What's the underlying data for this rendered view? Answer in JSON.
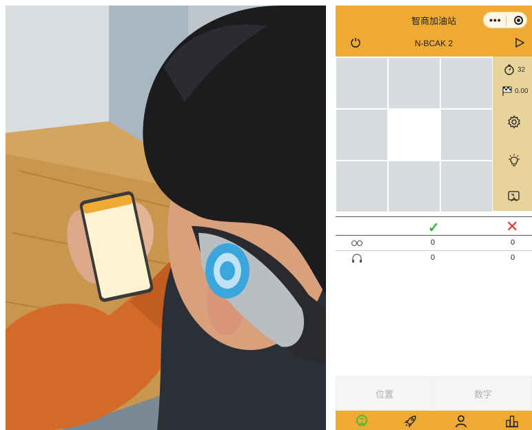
{
  "header": {
    "app_title": "智商加油站",
    "session_label": "N-BCAK 2",
    "menu_icon": "more-dots-icon",
    "close_icon": "target-circle-icon"
  },
  "grid": {
    "rows": 3,
    "cols": 3,
    "active_cell": 4
  },
  "sidebar": {
    "timer_value": "32",
    "score_value": "0.00",
    "icons": [
      "stopwatch-icon",
      "checkered-flag-icon",
      "gear-icon",
      "lightbulb-icon",
      "fullscreen-icon"
    ]
  },
  "scores": {
    "rows": [
      {
        "icon": "glasses-icon",
        "correct": "0",
        "wrong": "0"
      },
      {
        "icon": "headphones-icon",
        "correct": "0",
        "wrong": "0"
      }
    ]
  },
  "modes": {
    "position_label": "位置",
    "number_label": "数字"
  },
  "tabs": [
    "brain-icon",
    "rocket-icon",
    "person-icon",
    "ranking-icon"
  ],
  "colors": {
    "accent": "#eeaa32",
    "sidebar": "#e8d49a",
    "cell": "#d7dcdf",
    "correct": "#2fb52f",
    "wrong": "#e2372e",
    "active_tab": "#35c235"
  }
}
